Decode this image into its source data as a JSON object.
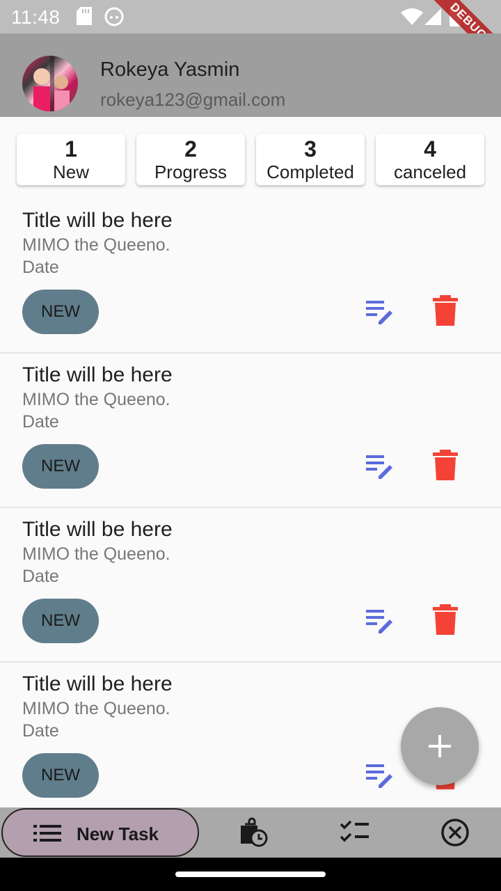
{
  "status_bar": {
    "time": "11:48",
    "debug_label": "DEBUG"
  },
  "user": {
    "name": "Rokeya Yasmin",
    "email": "rokeya123@gmail.com"
  },
  "summary": [
    {
      "count": "1",
      "label": "New"
    },
    {
      "count": "2",
      "label": "Progress"
    },
    {
      "count": "3",
      "label": "Completed"
    },
    {
      "count": "4",
      "label": "canceled"
    }
  ],
  "tasks": [
    {
      "title": "Title will be here",
      "description": "MIMO the Queeno.",
      "date": "Date",
      "status": "NEW"
    },
    {
      "title": "Title will be here",
      "description": "MIMO the Queeno.",
      "date": "Date",
      "status": "NEW"
    },
    {
      "title": "Title will be here",
      "description": "MIMO the Queeno.",
      "date": "Date",
      "status": "NEW"
    },
    {
      "title": "Title will be here",
      "description": "MIMO the Queeno.",
      "date": "Date",
      "status": "NEW"
    }
  ],
  "bottom_nav": {
    "active_label": "New Task",
    "items": [
      "list-icon",
      "progress-bag-icon",
      "checklist-icon",
      "cancel-circle-icon"
    ]
  },
  "colors": {
    "header_bg": "#9e9e9e",
    "chip_bg": "#607d8b",
    "edit_icon": "#5c6bdc",
    "delete_icon": "#f44336",
    "active_nav_bg": "#b39fae"
  }
}
